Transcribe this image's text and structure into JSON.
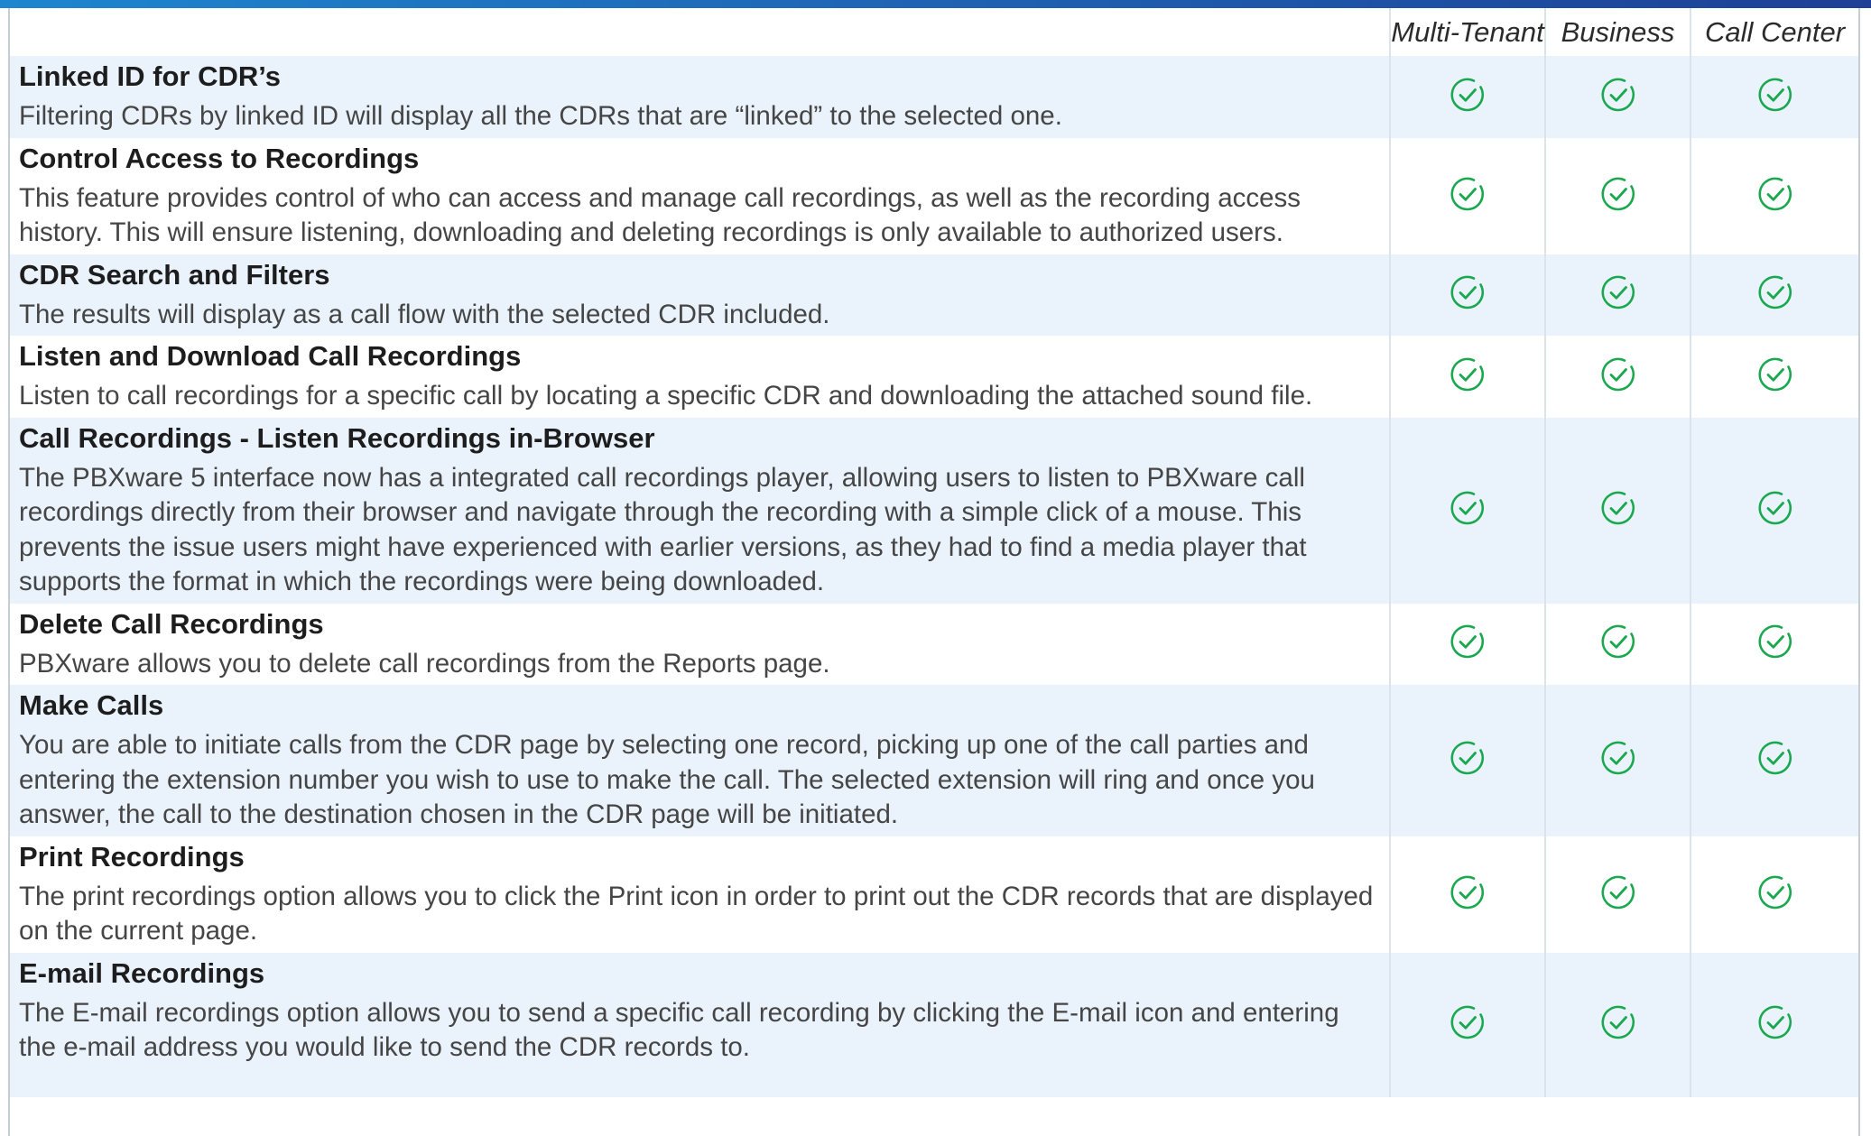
{
  "columns": {
    "feature": "",
    "tiers": [
      "Multi-Tenant",
      "Business",
      "Call Center"
    ]
  },
  "colors": {
    "top_bar_start": "#1d86cf",
    "top_bar_end": "#1e3f95",
    "row_shade": "#eaf3fc",
    "check": "#1aa84f"
  },
  "icons": {
    "availability": "check-circle-icon"
  },
  "rows": [
    {
      "name": "Linked ID for CDR’s",
      "description": "Filtering CDRs by linked ID will display all the CDRs that are “linked” to the selected one.",
      "available": [
        true,
        true,
        true
      ]
    },
    {
      "name": "Control Access to Recordings",
      "description": "This feature provides control of who can access and manage call recordings, as well as the recording access history. This will ensure listening, downloading and deleting recordings is only available to authorized users.",
      "available": [
        true,
        true,
        true
      ]
    },
    {
      "name": "CDR Search and Filters",
      "description": "The results will display as a call flow with the selected CDR included.",
      "available": [
        true,
        true,
        true
      ]
    },
    {
      "name": "Listen and Download Call Recordings",
      "description": "Listen to call recordings for a specific call by locating a specific CDR and downloading the attached sound file.",
      "available": [
        true,
        true,
        true
      ]
    },
    {
      "name": "Call Recordings - Listen Recordings in-Browser",
      "description": "The PBXware 5 interface now has a integrated call recordings player, allowing users to listen to PBXware call recordings directly from their browser and navigate through the recording with a simple click of a mouse. This prevents the issue users might have experienced with earlier versions, as they had to find a media player that supports the format in which the recordings were being downloaded.",
      "available": [
        true,
        true,
        true
      ]
    },
    {
      "name": "Delete Call Recordings",
      "description": "PBXware allows you to delete call recordings from the Reports page.",
      "available": [
        true,
        true,
        true
      ]
    },
    {
      "name": "Make Calls",
      "description": "You are able to initiate calls from the CDR page by selecting one record, picking up one of the call parties and entering the extension number you wish to use to make the call. The selected extension will ring and once you answer, the call to the destination chosen in the CDR page will be initiated.",
      "available": [
        true,
        true,
        true
      ]
    },
    {
      "name": "Print Recordings",
      "description": "The print recordings option allows you to click the Print icon in order to print out the CDR records that are displayed on the current page.",
      "available": [
        true,
        true,
        true
      ]
    },
    {
      "name": "E-mail Recordings",
      "description": "The E-mail recordings option allows you to send a specific call recording by clicking the E-mail icon and entering the e-mail address you would like to send the CDR records to.",
      "available": [
        true,
        true,
        true
      ]
    }
  ]
}
